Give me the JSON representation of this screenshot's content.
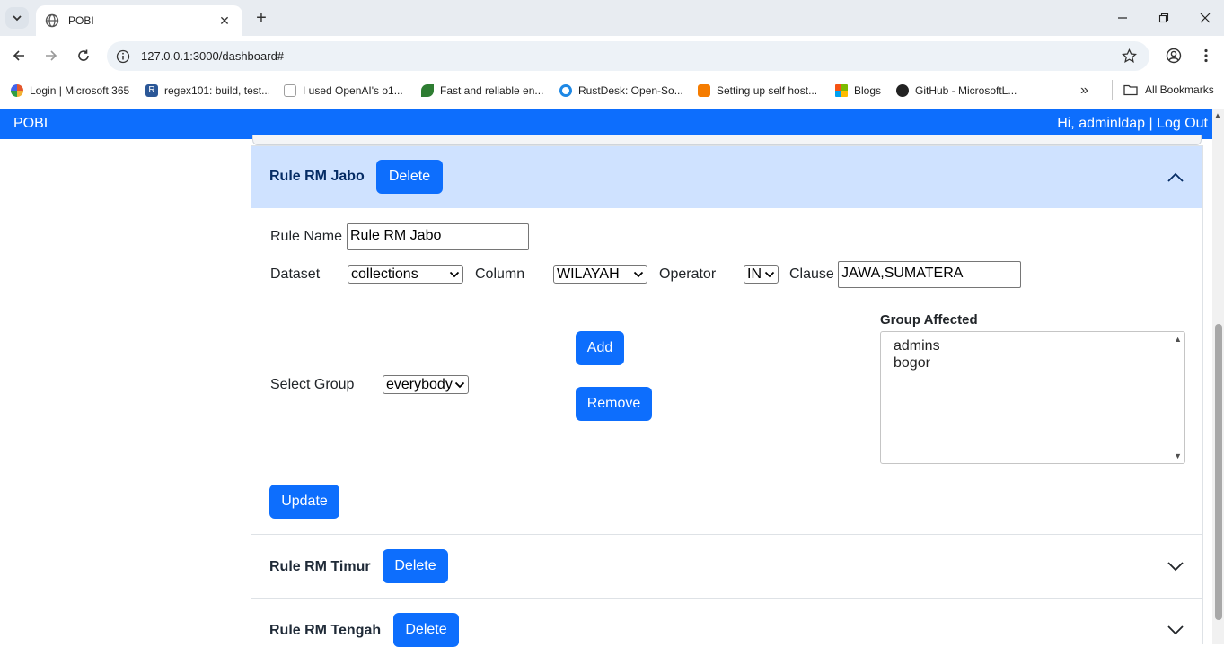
{
  "browser": {
    "tab_title": "POBI",
    "url": "127.0.0.1:3000/dashboard#",
    "bookmarks": [
      {
        "label": "Login | Microsoft 365",
        "color": "#e4572e"
      },
      {
        "label": "regex101: build, test...",
        "color": "#2b5797"
      },
      {
        "label": "I used OpenAI's o1...",
        "color": "#9e9e9e"
      },
      {
        "label": "Fast and reliable en...",
        "color": "#2e7d32"
      },
      {
        "label": "RustDesk: Open-So...",
        "color": "#1e88e5"
      },
      {
        "label": "Setting up self host...",
        "color": "#f57c00"
      },
      {
        "label": "Blogs",
        "color": "#43a047"
      },
      {
        "label": "GitHub - MicrosoftL...",
        "color": "#222222"
      }
    ],
    "all_bookmarks": "All Bookmarks"
  },
  "app": {
    "brand": "POBI",
    "user_text": "Hi, adminldap | Log Out",
    "accent": "#0d6efd"
  },
  "rules": [
    {
      "title": "Rule RM Jabo",
      "delete_label": "Delete",
      "expanded": true,
      "form": {
        "rule_name_label": "Rule Name",
        "rule_name_value": "Rule RM Jabo",
        "dataset_label": "Dataset",
        "dataset_value": "collections",
        "column_label": "Column",
        "column_value": "WILAYAH",
        "operator_label": "Operator",
        "operator_value": "IN",
        "clause_label": "Clause",
        "clause_value": "JAWA,SUMATERA",
        "select_group_label": "Select Group",
        "select_group_value": "everybody",
        "add_label": "Add",
        "remove_label": "Remove",
        "group_affected_label": "Group Affected",
        "group_affected": [
          "admins",
          "bogor"
        ],
        "update_label": "Update"
      }
    },
    {
      "title": "Rule RM Timur",
      "delete_label": "Delete",
      "expanded": false
    },
    {
      "title": "Rule RM Tengah",
      "delete_label": "Delete",
      "expanded": false
    }
  ]
}
